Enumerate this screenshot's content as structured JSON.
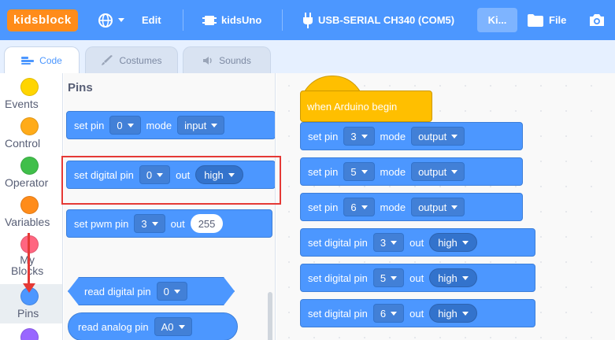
{
  "menubar": {
    "logo": "kidsblock",
    "edit_label": "Edit",
    "device_label": "kidsUno",
    "port_label": "USB-SERIAL CH340 (COM5)",
    "ki_label": "Ki...",
    "file_label": "File",
    "bg_color": "#4c97ff",
    "logo_color": "#ff8c1a"
  },
  "tabs": [
    {
      "label": "Code",
      "icon": "code-icon",
      "active": true
    },
    {
      "label": "Costumes",
      "icon": "brush-icon",
      "active": false
    },
    {
      "label": "Sounds",
      "icon": "speaker-icon",
      "active": false
    }
  ],
  "categories": [
    {
      "label": "Events",
      "color": "#ffd500"
    },
    {
      "label": "Control",
      "color": "#ffab19"
    },
    {
      "label": "Operator",
      "color": "#40bf4a"
    },
    {
      "label": "Variables",
      "color": "#ff8c1a"
    },
    {
      "label": "My\nBlocks",
      "color": "#ff6680"
    },
    {
      "label": "Pins",
      "color": "#4c97ff",
      "selected": true
    },
    {
      "label": "",
      "color": "#9966ff"
    }
  ],
  "palette": {
    "title": "Pins",
    "set_pin": {
      "text": "set pin",
      "pin": "0",
      "mode_text": "mode",
      "mode": "input"
    },
    "set_digital": {
      "text": "set digital pin",
      "pin": "0",
      "out_text": "out",
      "level": "high"
    },
    "set_pwm": {
      "text": "set pwm pin",
      "pin": "3",
      "out_text": "out",
      "value": "255"
    },
    "read_digital": {
      "text": "read digital pin",
      "pin": "0"
    },
    "read_analog": {
      "text": "read analog pin",
      "pin": "A0"
    }
  },
  "script": {
    "hat": "when Arduino begin",
    "set_text": "set pin",
    "mode_text": "mode",
    "digital_text": "set digital pin",
    "out_text": "out",
    "mode_blocks": [
      {
        "pin": "3",
        "mode": "output"
      },
      {
        "pin": "5",
        "mode": "output"
      },
      {
        "pin": "6",
        "mode": "output"
      }
    ],
    "digital_blocks": [
      {
        "pin": "3",
        "level": "high"
      },
      {
        "pin": "5",
        "level": "high"
      },
      {
        "pin": "6",
        "level": "high"
      }
    ]
  }
}
